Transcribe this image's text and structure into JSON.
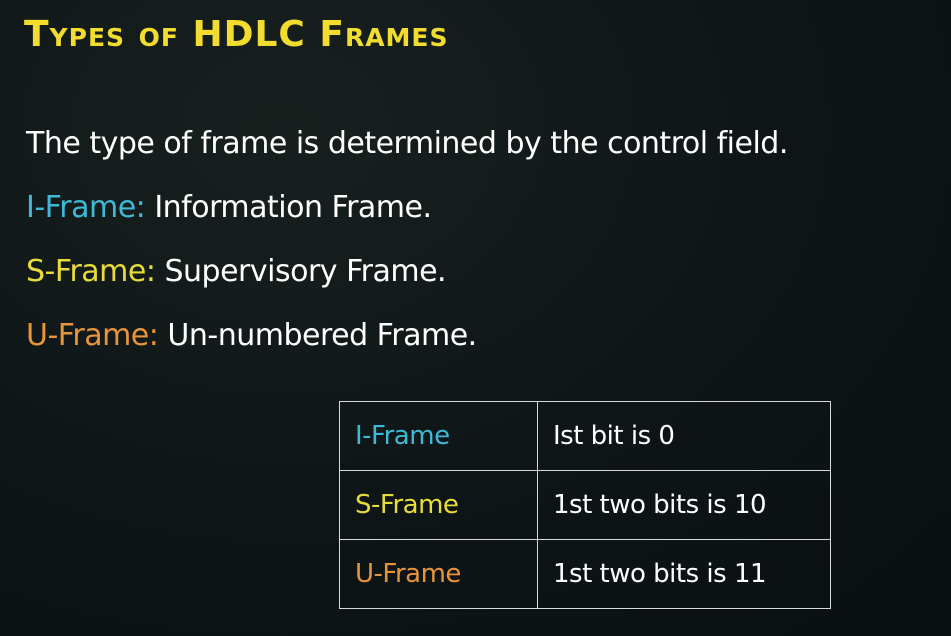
{
  "slide": {
    "title": "Types of HDLC Frames",
    "intro": "The type of frame is determined by the control field.",
    "items": [
      {
        "label": "I-Frame:",
        "desc": "Information Frame."
      },
      {
        "label": "S-Frame:",
        "desc": "Supervisory Frame."
      },
      {
        "label": "U-Frame:",
        "desc": "Un-numbered Frame."
      }
    ],
    "table": {
      "rows": [
        {
          "type": "I-Frame",
          "rule": "Ist bit is 0"
        },
        {
          "type": "S-Frame",
          "rule": "1st two bits is 10"
        },
        {
          "type": "U-Frame",
          "rule": "1st two bits is 11"
        }
      ]
    }
  },
  "colors": {
    "title": "#f2dd2e",
    "i_frame": "#3fb9d6",
    "s_frame": "#e8dc3a",
    "u_frame": "#e8953a",
    "background": "#0d1416"
  }
}
